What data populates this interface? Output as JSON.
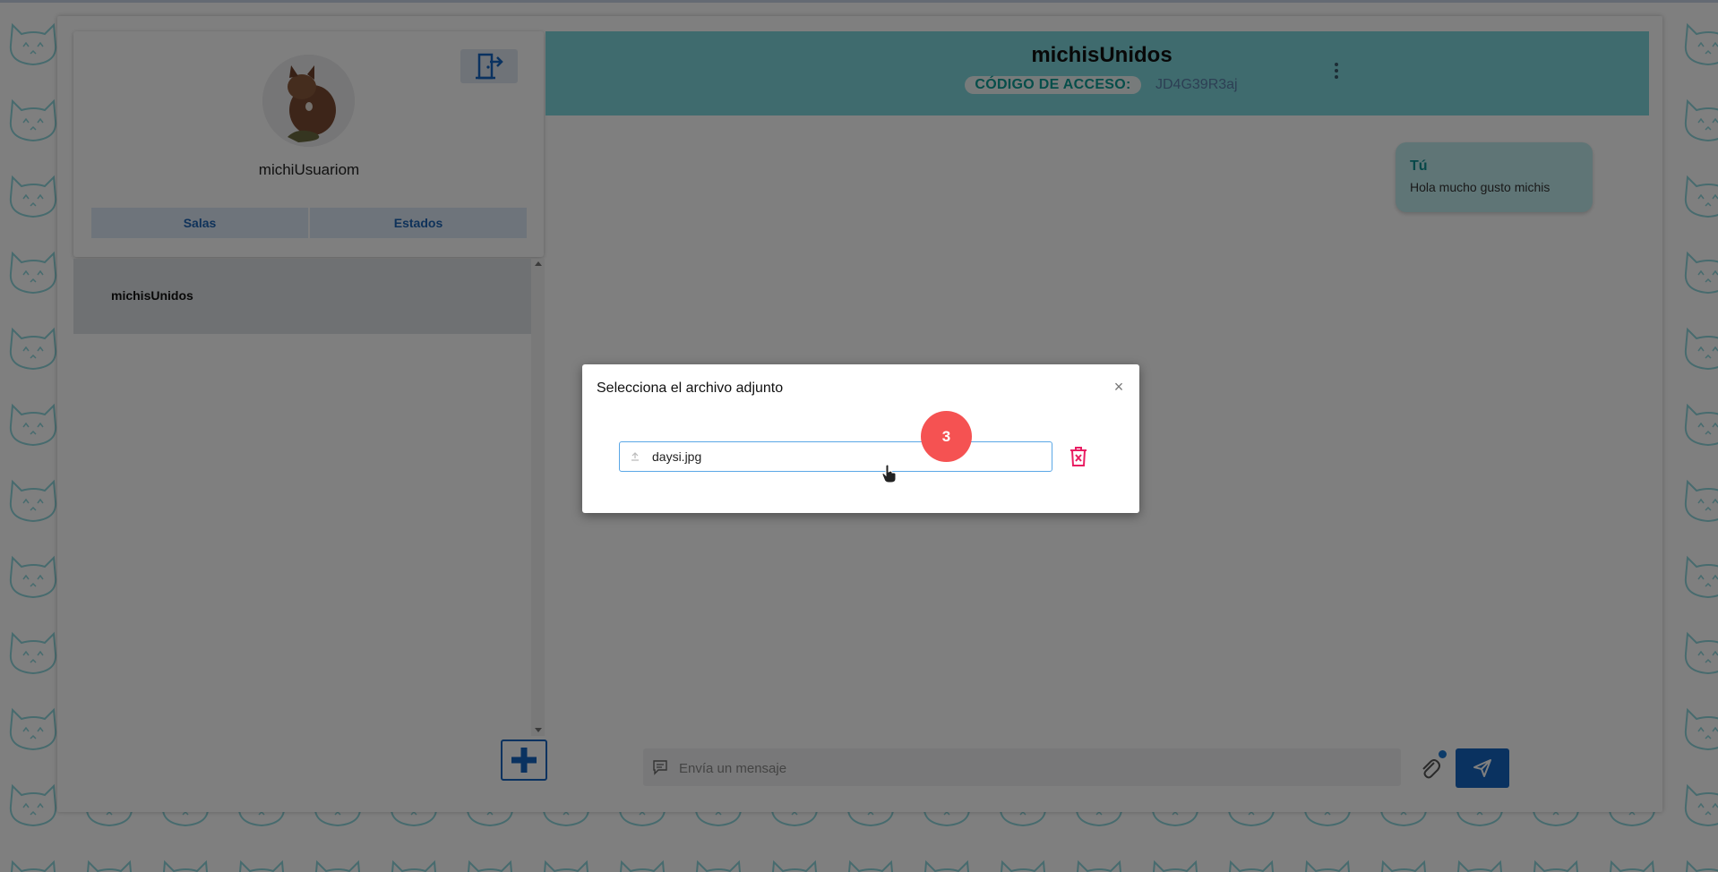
{
  "sidebar": {
    "username": "michiUsuariom",
    "tabs": [
      {
        "label": "Salas"
      },
      {
        "label": "Estados"
      }
    ],
    "rooms": [
      {
        "name": "michisUnidos"
      }
    ],
    "icons": {
      "exit": "exit-door-icon",
      "add": "plus-icon"
    }
  },
  "chat": {
    "title": "michisUnidos",
    "access_label": "CÓDIGO DE ACCESO:",
    "access_code": "JD4G39R3aj",
    "messages": [
      {
        "sender": "Tú",
        "text": "Hola mucho gusto michis"
      }
    ],
    "input_placeholder": "Envía un mensaje"
  },
  "modal": {
    "title": "Selecciona el archivo adjunto",
    "close_symbol": "×",
    "file_name": "daysi.jpg"
  },
  "step_badge": "3",
  "colors": {
    "header": "#7ed6dc",
    "primary": "#1565c0",
    "accent_teal": "#0c9c94",
    "danger": "#e91e63",
    "badge": "#f55252"
  }
}
